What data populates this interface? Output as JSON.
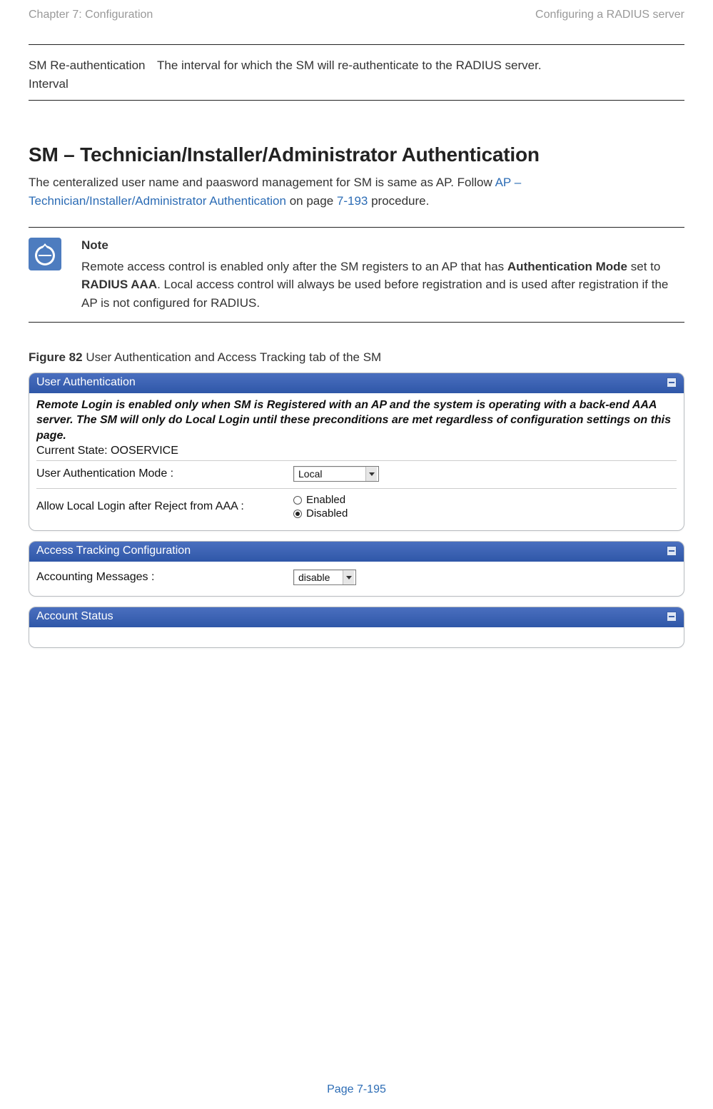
{
  "header": {
    "left": "Chapter 7:  Configuration",
    "right": "Configuring a RADIUS server"
  },
  "definition": {
    "term": "SM Re-authentication Interval",
    "desc": "The interval for which the SM will re-authenticate to the RADIUS server."
  },
  "section": {
    "title": "SM – Technician/Installer/Administrator Authentication",
    "intro_pre": "The centeralized user name and paasword management for SM is same as AP. Follow ",
    "intro_link": "AP – Technician/Installer/Administrator Authentication",
    "intro_mid": " on page ",
    "intro_page": "7-193",
    "intro_post": " procedure."
  },
  "note": {
    "title": "Note",
    "pre": "Remote access control is enabled only after the SM registers to an AP that has ",
    "b1": "Authentication Mode",
    "mid1": " set to ",
    "b2": "RADIUS AAA",
    "post": ". Local access control will always be used before registration and is used after registration if the AP is not configured for RADIUS."
  },
  "figure": {
    "label_bold": "Figure 82",
    "label_rest": " User Authentication and Access Tracking tab of the SM"
  },
  "panels": {
    "userauth": {
      "title": "User Authentication",
      "intro": "Remote Login is enabled only when SM is Registered with an AP and the system is operating with a back-end AAA server. The SM will only do Local Login until these preconditions are met regardless of configuration settings on this page.",
      "state_label": "Current State: OOSERVICE",
      "row1_label": "User Authentication Mode :",
      "row1_value": "Local",
      "row2_label": "Allow Local Login after Reject from AAA :",
      "row2_opt1": "Enabled",
      "row2_opt2": "Disabled"
    },
    "tracking": {
      "title": "Access Tracking Configuration",
      "row1_label": "Accounting Messages :",
      "row1_value": "disable"
    },
    "status": {
      "title": "Account Status"
    }
  },
  "footer": {
    "page": "Page 7-195"
  }
}
